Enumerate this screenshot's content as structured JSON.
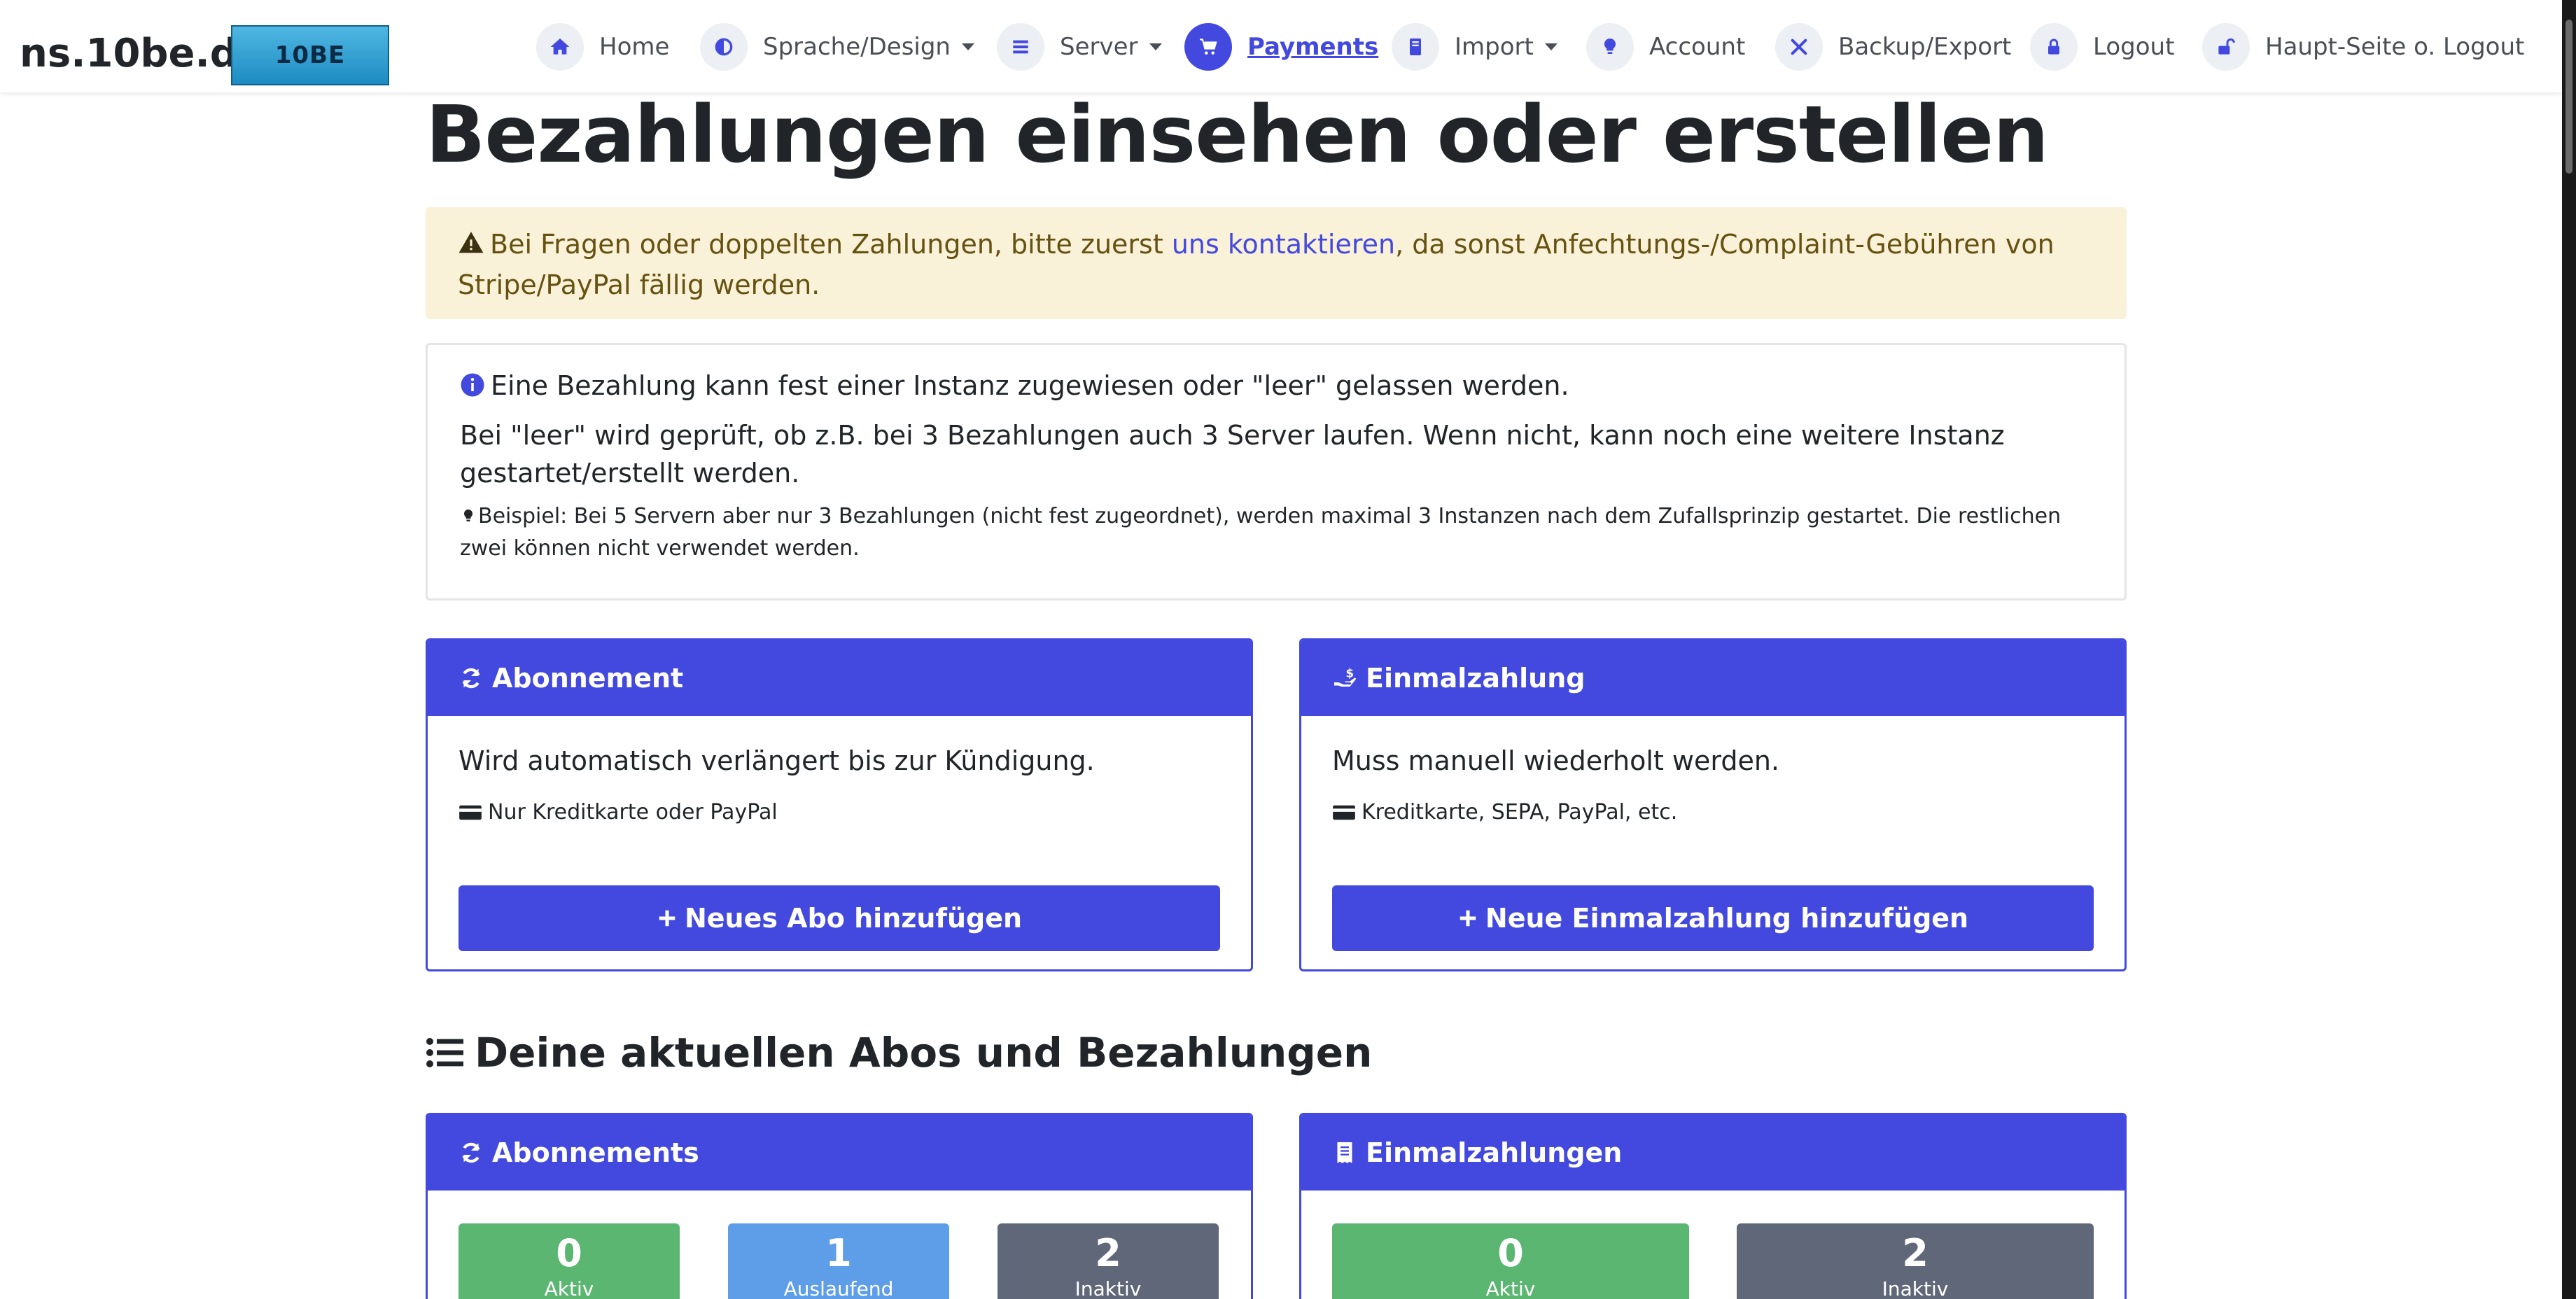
{
  "navbar": {
    "brand": "ns.10be.de",
    "logo_text": "10BE",
    "items": [
      {
        "label": "Home",
        "icon": "home-icon"
      },
      {
        "label": "Sprache/Design",
        "icon": "half-circle-icon",
        "dropdown": true
      },
      {
        "label": "Server",
        "icon": "server-list-icon",
        "dropdown": true
      },
      {
        "label": "Payments",
        "icon": "cart-icon",
        "active": true
      },
      {
        "label": "Import",
        "icon": "book-icon",
        "dropdown": true
      },
      {
        "label": "Account",
        "icon": "lightbulb-icon"
      },
      {
        "label": "Backup/Export",
        "icon": "tools-icon"
      },
      {
        "label": "Logout",
        "icon": "lock-icon"
      },
      {
        "label": "Haupt-Seite o. Logout",
        "icon": "unlock-icon"
      }
    ]
  },
  "page": {
    "title": "Bezahlungen einsehen oder erstellen"
  },
  "warning": {
    "before_link": "Bei Fragen oder doppelten Zahlungen, bitte zuerst ",
    "link": "uns kontaktieren",
    "after_link": ", da sonst Anfechtungs-/Complaint-Gebühren von Stripe/PayPal fällig werden."
  },
  "info": {
    "line1": "Eine Bezahlung kann fest einer Instanz zugewiesen oder \"leer\" gelassen werden.",
    "line2": "Bei \"leer\" wird geprüft, ob z.B. bei 3 Bezahlungen auch 3 Server laufen. Wenn nicht, kann noch eine weitere Instanz gestartet/erstellt werden.",
    "line3": "Beispiel: Bei 5 Servern aber nur 3 Bezahlungen (nicht fest zugeordnet), werden maximal 3 Instanzen nach dem Zufallsprinzip gestartet. Die restlichen zwei können nicht verwendet werden."
  },
  "cards": {
    "subscription": {
      "title": "Abonnement",
      "text": "Wird automatisch verlängert bis zur Kündigung.",
      "methods": "Nur Kreditkarte oder PayPal",
      "button": "Neues Abo hinzufügen"
    },
    "onetime": {
      "title": "Einmalzahlung",
      "text": "Muss manuell wiederholt werden.",
      "methods": "Kreditkarte, SEPA, PayPal, etc.",
      "button": "Neue Einmalzahlung hinzufügen"
    }
  },
  "current": {
    "heading": "Deine aktuellen Abos und Bezahlungen",
    "subscriptions": {
      "title": "Abonnements",
      "stats": [
        {
          "value": "0",
          "label": "Aktiv"
        },
        {
          "value": "1",
          "label": "Auslaufend"
        },
        {
          "value": "2",
          "label": "Inaktiv"
        }
      ]
    },
    "payments": {
      "title": "Einmalzahlungen",
      "stats": [
        {
          "value": "0",
          "label": "Aktiv"
        },
        {
          "value": "2",
          "label": "Inaktiv"
        }
      ]
    }
  },
  "colors": {
    "primary": "#4349de",
    "warning_bg": "#faf1d9",
    "warning_text": "#665210",
    "success": "#5bb672",
    "info": "#5e9ee8",
    "secondary": "#5f6778"
  }
}
